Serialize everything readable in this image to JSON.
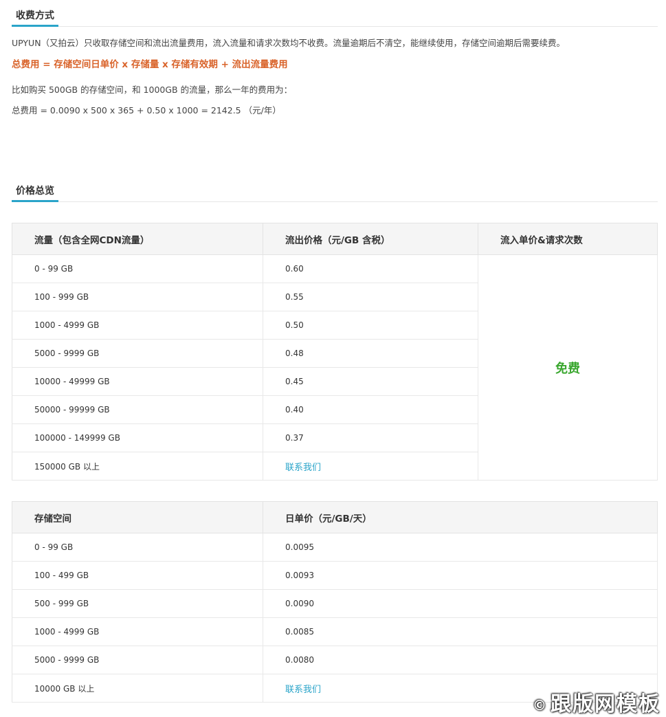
{
  "section1": {
    "title": "收费方式"
  },
  "intro": "UPYUN（又拍云）只收取存储空间和流出流量费用，流入流量和请求次数均不收费。流量逾期后不清空，能继续使用，存储空间逾期后需要续费。",
  "formula": "总费用 = 存储空间日单价 x 存储量 x 存储有效期 + 流出流量费用",
  "example_line1": "比如购买 500GB 的存储空间，和 1000GB 的流量，那么一年的费用为：",
  "example_line2": "总费用 = 0.0090 x 500 x 365 + 0.50 x 1000 = 2142.5 （元/年）",
  "section2": {
    "title": "价格总览"
  },
  "traffic_table": {
    "headers": [
      "流量（包含全网CDN流量）",
      "流出价格（元/GB 含税）",
      "流入单价&请求次数"
    ],
    "rows": [
      {
        "range": "0 - 99 GB",
        "price": "0.60"
      },
      {
        "range": "100 - 999 GB",
        "price": "0.55"
      },
      {
        "range": "1000 - 4999 GB",
        "price": "0.50"
      },
      {
        "range": "5000 - 9999 GB",
        "price": "0.48"
      },
      {
        "range": "10000 - 49999 GB",
        "price": "0.45"
      },
      {
        "range": "50000 - 99999 GB",
        "price": "0.40"
      },
      {
        "range": "100000 - 149999 GB",
        "price": "0.37"
      },
      {
        "range": "150000 GB 以上",
        "price": "联系我们"
      }
    ],
    "free_label": "免费"
  },
  "storage_table": {
    "headers": [
      "存储空间",
      "日单价（元/GB/天）"
    ],
    "rows": [
      {
        "range": "0 - 99 GB",
        "price": "0.0095"
      },
      {
        "range": "100 - 499 GB",
        "price": "0.0093"
      },
      {
        "range": "500 - 999 GB",
        "price": "0.0090"
      },
      {
        "range": "1000 - 4999 GB",
        "price": "0.0085"
      },
      {
        "range": "5000 - 9999 GB",
        "price": "0.0080"
      },
      {
        "range": "10000 GB 以上",
        "price": "联系我们"
      }
    ]
  },
  "watermark": {
    "symbol": "©",
    "text": "跟版网模板"
  },
  "colors": {
    "accent": "#2aa4c9",
    "formula": "#d9632a",
    "free": "#3aa72f",
    "header_bg": "#f5f5f5"
  }
}
